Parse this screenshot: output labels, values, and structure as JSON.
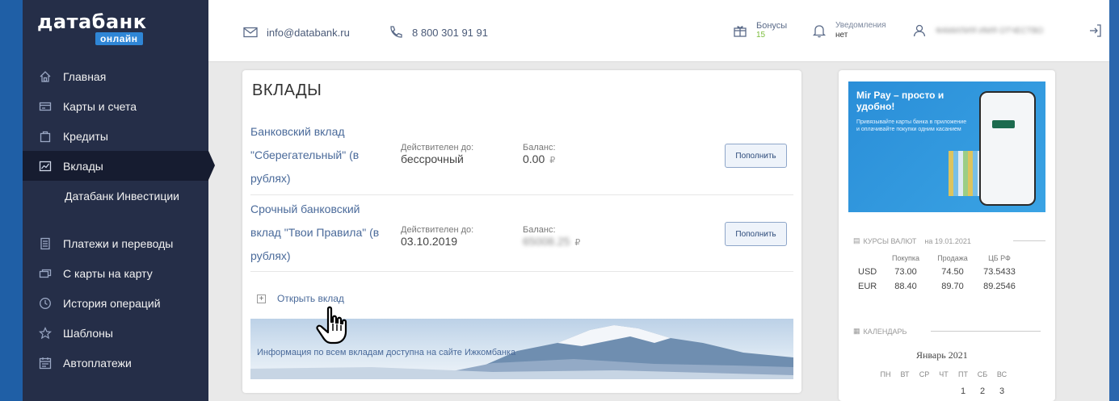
{
  "logo": {
    "main": "датабанк",
    "sub": "онлайн"
  },
  "sidebar": {
    "items": [
      {
        "label": "Главная",
        "icon": "home-icon"
      },
      {
        "label": "Карты и счета",
        "icon": "card-icon"
      },
      {
        "label": "Кредиты",
        "icon": "bag-icon"
      },
      {
        "label": "Вклады",
        "icon": "chart-icon"
      },
      {
        "label": "Датабанк Инвестиции"
      },
      {
        "label": "Платежи и переводы",
        "icon": "document-icon"
      },
      {
        "label": "С карты на карту",
        "icon": "cards-icon"
      },
      {
        "label": "История операций",
        "icon": "clock-icon"
      },
      {
        "label": "Шаблоны",
        "icon": "star-icon"
      },
      {
        "label": "Автоплатежи",
        "icon": "calendar-icon"
      }
    ],
    "active_index": 3
  },
  "topbar": {
    "email": "info@databank.ru",
    "phone": "8 800 301 91 91",
    "bonuses_label": "Бонусы",
    "bonuses_value": "15",
    "notifications_label": "Уведомления",
    "notifications_value": "нет",
    "user_name": "ФАМИЛИЯ ИМЯ ОТЧЕСТВО"
  },
  "deposits": {
    "title": "ВКЛАДЫ",
    "valid_label": "Действителен до:",
    "balance_label": "Баланс:",
    "topup_label": "Пополнить",
    "items": [
      {
        "name": "Банковский вклад \"Сберегательный\" (в рублях)",
        "valid_until": "бессрочный",
        "balance": "0.00",
        "currency": "₽"
      },
      {
        "name": "Срочный банковский вклад \"Твои Правила\" (в рублях)",
        "valid_until": "03.10.2019",
        "balance": "65008.25",
        "currency": "₽"
      }
    ],
    "open_label": "Открыть вклад",
    "banner_text": "Информация по всем вкладам доступна на сайте Ижкомбанка"
  },
  "promo": {
    "title": "Mir Pay – просто и удобно!",
    "text": "Привязывайте карты банка в приложение и оплачивайте покупки одним касанием"
  },
  "rates": {
    "title": "КУРСЫ ВАЛЮТ",
    "date": "на 19.01.2021",
    "headers": [
      "Покупка",
      "Продажа",
      "ЦБ РФ"
    ],
    "rows": [
      {
        "cur": "USD",
        "buy": "73.00",
        "sell": "74.50",
        "cb": "73.5433"
      },
      {
        "cur": "EUR",
        "buy": "88.40",
        "sell": "89.70",
        "cb": "89.2546"
      }
    ]
  },
  "calendar": {
    "title": "КАЛЕНДАРЬ",
    "month": "Январь 2021",
    "days": [
      "ПН",
      "ВТ",
      "СР",
      "ЧТ",
      "ПТ",
      "СБ",
      "ВС"
    ],
    "first_row": [
      "",
      "",
      "",
      "",
      "1",
      "2",
      "3"
    ]
  },
  "colors": {
    "sidebar": "#252e48",
    "accent": "#2f86d6",
    "link": "#4a6a9a"
  }
}
